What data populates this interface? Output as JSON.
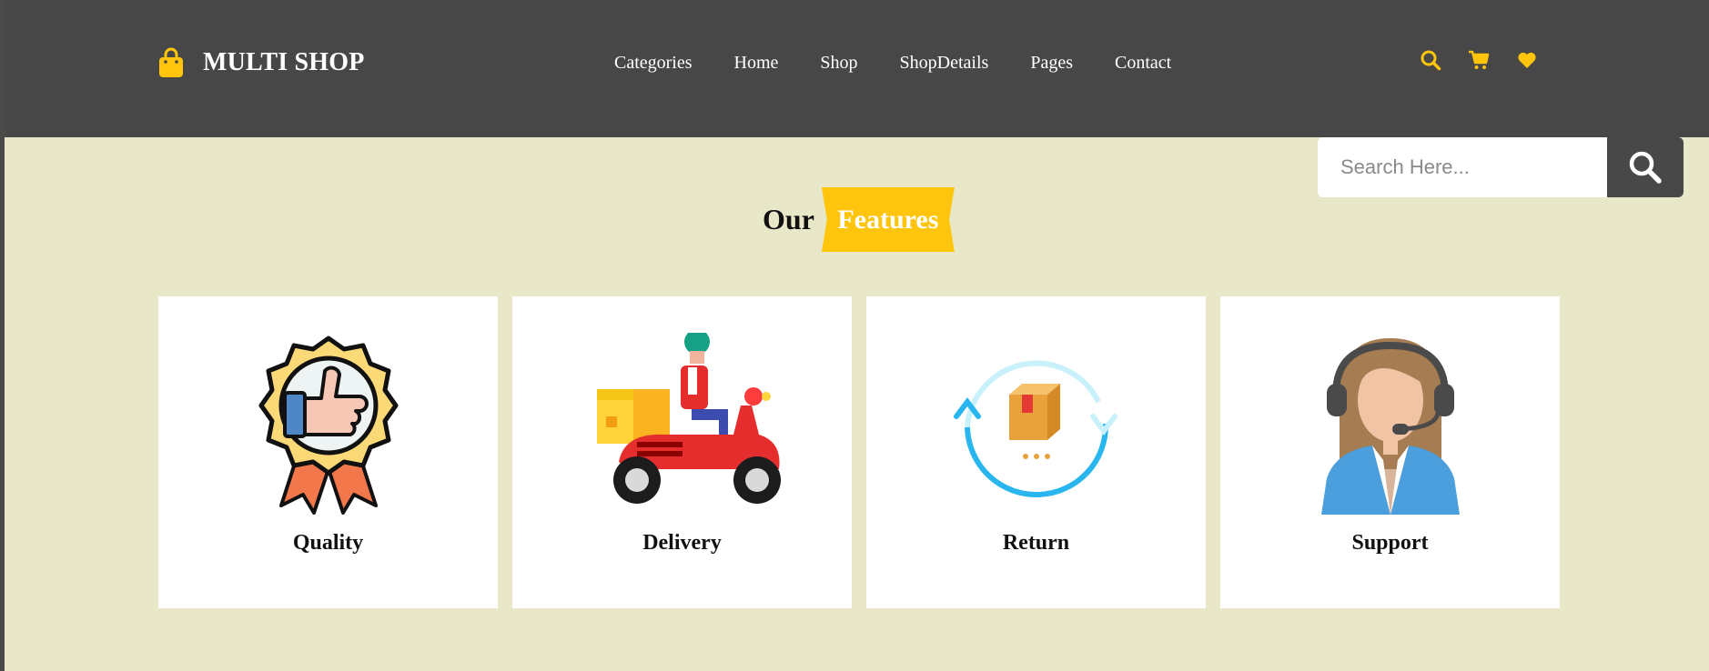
{
  "brand": {
    "name": "MULTI SHOP",
    "icon": "shopping-bag-icon"
  },
  "nav": {
    "items": [
      {
        "label": "Categories"
      },
      {
        "label": "Home"
      },
      {
        "label": "Shop"
      },
      {
        "label": "ShopDetails"
      },
      {
        "label": "Pages"
      },
      {
        "label": "Contact"
      }
    ],
    "icons": [
      "search-icon",
      "cart-icon",
      "heart-icon"
    ]
  },
  "search": {
    "placeholder": "Search Here...",
    "value": ""
  },
  "section": {
    "title_plain": "Our",
    "title_highlight": "Features"
  },
  "features": [
    {
      "label": "Quality",
      "icon": "quality-badge-icon"
    },
    {
      "label": "Delivery",
      "icon": "delivery-scooter-icon"
    },
    {
      "label": "Return",
      "icon": "return-box-icon"
    },
    {
      "label": "Support",
      "icon": "support-agent-icon"
    }
  ],
  "colors": {
    "accent": "#ffc40c",
    "navbar": "#474747",
    "background": "#e8e8c9",
    "card": "#ffffff"
  }
}
